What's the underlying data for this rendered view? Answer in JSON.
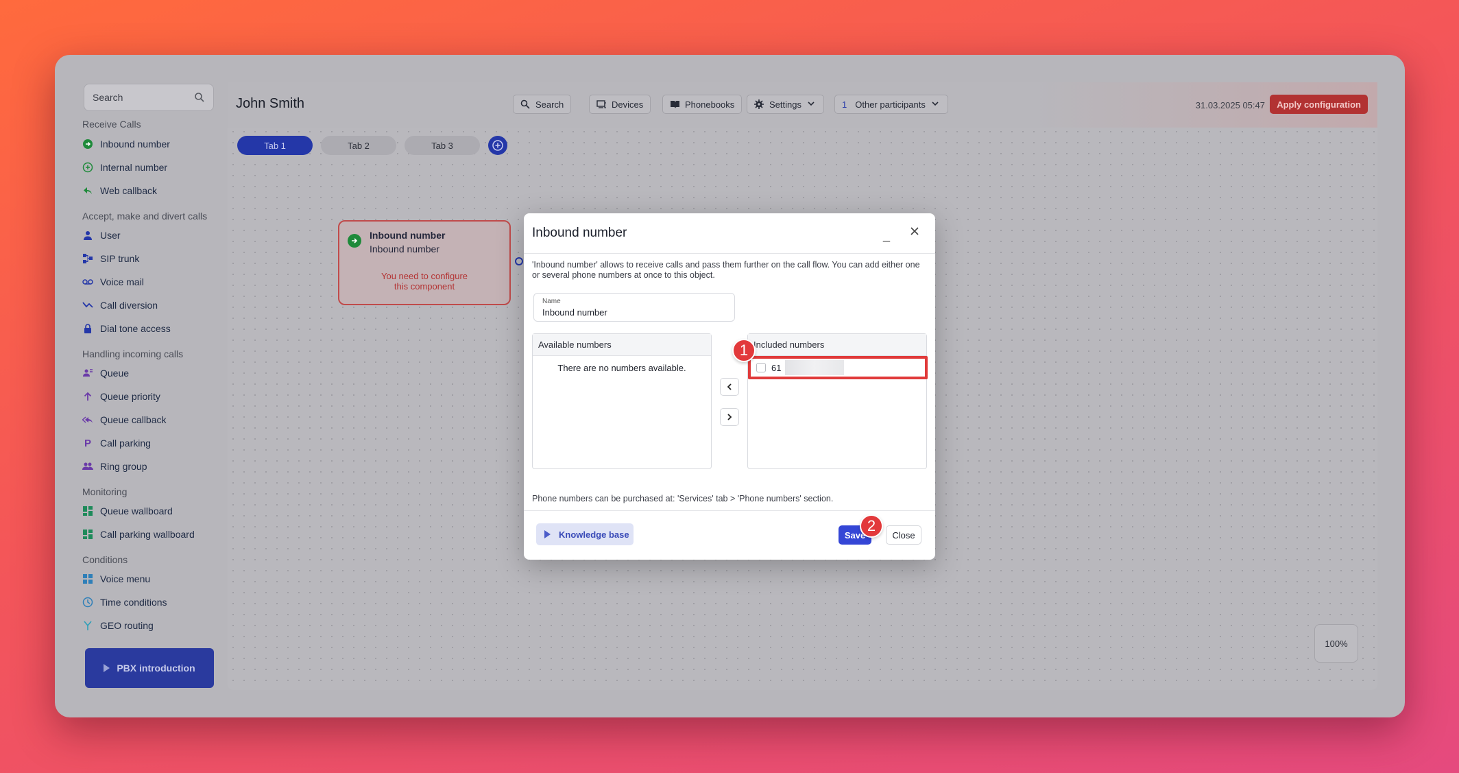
{
  "sidebar": {
    "search_placeholder": "Search",
    "sections": [
      {
        "title": "Receive Calls",
        "items": [
          {
            "label": "Inbound number",
            "icon": "arrow-circle-green-icon"
          },
          {
            "label": "Internal number",
            "icon": "plus-circle-green-icon"
          },
          {
            "label": "Web callback",
            "icon": "reply-arrow-green-icon"
          }
        ]
      },
      {
        "title": "Accept, make and divert calls",
        "items": [
          {
            "label": "User",
            "icon": "user-icon"
          },
          {
            "label": "SIP trunk",
            "icon": "network-icon"
          },
          {
            "label": "Voice mail",
            "icon": "voicemail-icon"
          },
          {
            "label": "Call diversion",
            "icon": "diversion-icon"
          },
          {
            "label": "Dial tone access",
            "icon": "lock-icon"
          }
        ]
      },
      {
        "title": "Handling incoming calls",
        "items": [
          {
            "label": "Queue",
            "icon": "queue-icon"
          },
          {
            "label": "Queue priority",
            "icon": "arrow-up-icon"
          },
          {
            "label": "Queue callback",
            "icon": "reply-all-icon"
          },
          {
            "label": "Call parking",
            "icon": "parking-p-icon"
          },
          {
            "label": "Ring group",
            "icon": "group-icon"
          }
        ]
      },
      {
        "title": "Monitoring",
        "items": [
          {
            "label": "Queue wallboard",
            "icon": "dashboard-icon"
          },
          {
            "label": "Call parking wallboard",
            "icon": "dashboard-icon"
          }
        ]
      },
      {
        "title": "Conditions",
        "items": [
          {
            "label": "Voice menu",
            "icon": "grid-icon"
          },
          {
            "label": "Time conditions",
            "icon": "clock-icon"
          },
          {
            "label": "GEO routing",
            "icon": "fork-icon"
          }
        ]
      }
    ],
    "pbx_button": "PBX introduction"
  },
  "header": {
    "user_name": "John Smith",
    "search": "Search",
    "devices": "Devices",
    "phonebooks": "Phonebooks",
    "settings": "Settings",
    "participants_count": "1",
    "participants": "Other participants",
    "datetime": "31.03.2025 05:47",
    "apply": "Apply configuration"
  },
  "tabs": [
    "Tab 1",
    "Tab 2",
    "Tab 3"
  ],
  "node": {
    "title": "Inbound number",
    "subtitle": "Inbound number",
    "warning_line1": "You need to configure",
    "warning_line2": "this component"
  },
  "zoom": "100%",
  "modal": {
    "title": "Inbound number",
    "minimize": "_",
    "description": "'Inbound number' allows to receive calls and pass them further on the call flow. You can add either one or several phone numbers at once to this object.",
    "name_label": "Name",
    "name_value": "Inbound number",
    "available_header": "Available numbers",
    "available_empty": "There are no numbers available.",
    "included_header": "Included numbers",
    "included_numbers": [
      "61"
    ],
    "footer_note": "Phone numbers can be purchased at: 'Services' tab > 'Phone numbers' section.",
    "knowledge_base": "Knowledge base",
    "save": "Save",
    "close": "Close"
  },
  "annotations": {
    "step1": "1",
    "step2": "2"
  },
  "colors": {
    "accent": "#3446d6",
    "danger": "#e03a3a",
    "apply": "#b23232"
  }
}
